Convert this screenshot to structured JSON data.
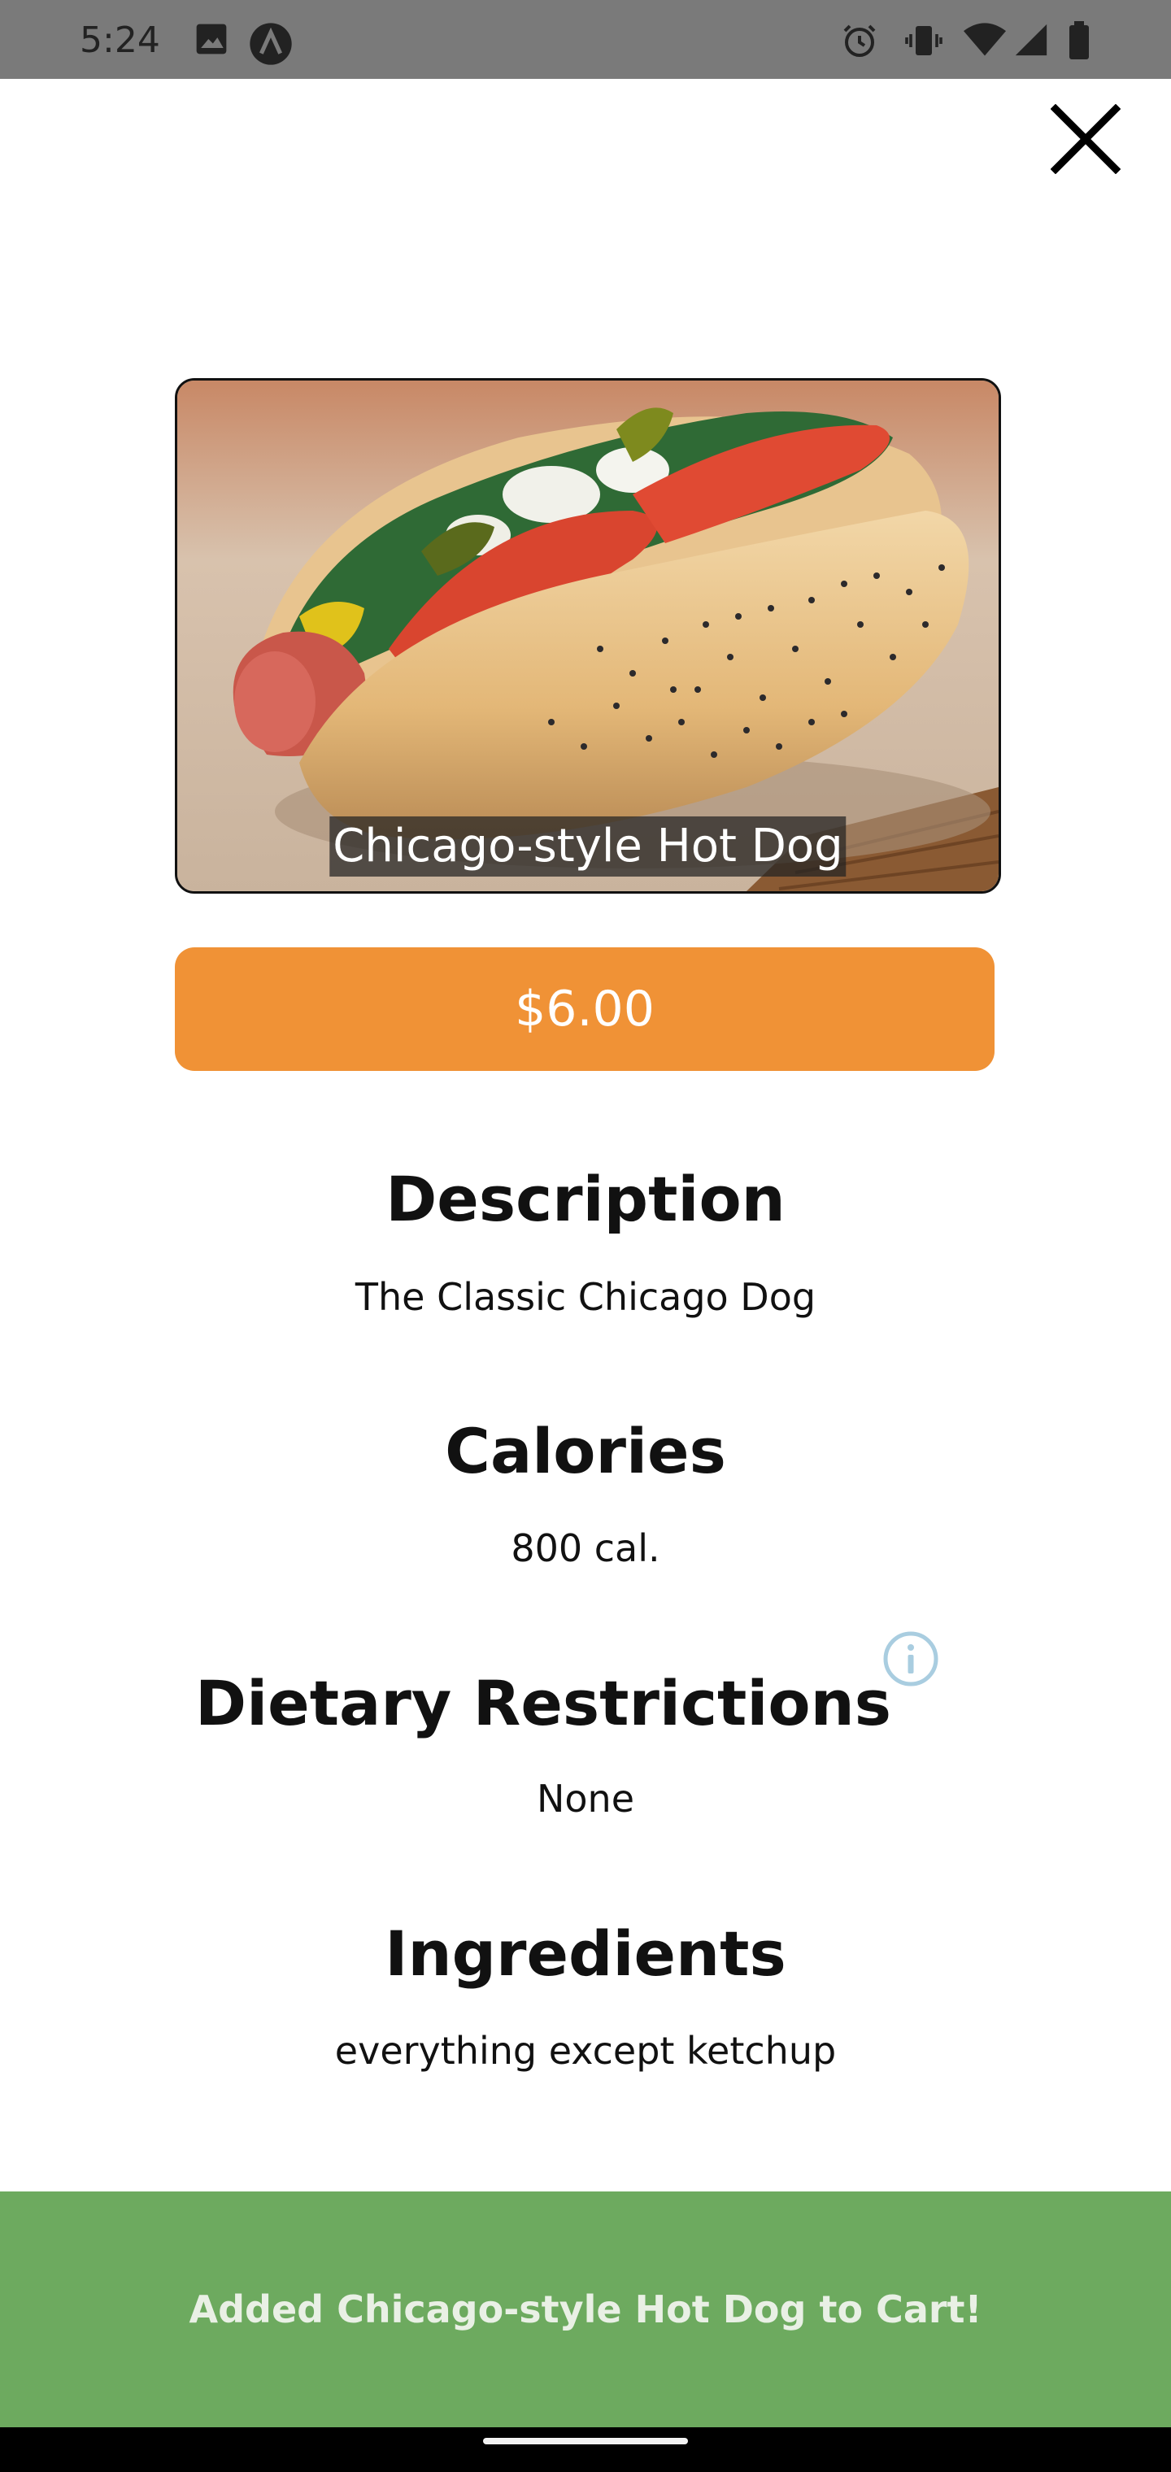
{
  "status_bar": {
    "time": "5:24",
    "icons_left": [
      "image-icon",
      "app-a-icon"
    ],
    "icons_right": [
      "alarm-icon",
      "vibrate-icon",
      "wifi-icon",
      "signal-icon",
      "battery-icon"
    ]
  },
  "item": {
    "caption": "Chicago-style Hot Dog",
    "price": "$6.00"
  },
  "sections": {
    "description_title": "Description",
    "description_text": "The Classic Chicago Dog",
    "calories_title": "Calories",
    "calories_text": "800 cal.",
    "dietary_title": "Dietary Restrictions",
    "dietary_text": "None",
    "ingredients_title": "Ingredients",
    "ingredients_text": "everything except ketchup"
  },
  "snackbar": {
    "message": "Added Chicago-style Hot Dog to Cart!"
  },
  "colors": {
    "price_button": "#f09236",
    "snackbar": "#6daa5f",
    "status_bar": "#7a7a7a",
    "info_icon": "#a9cde0"
  }
}
